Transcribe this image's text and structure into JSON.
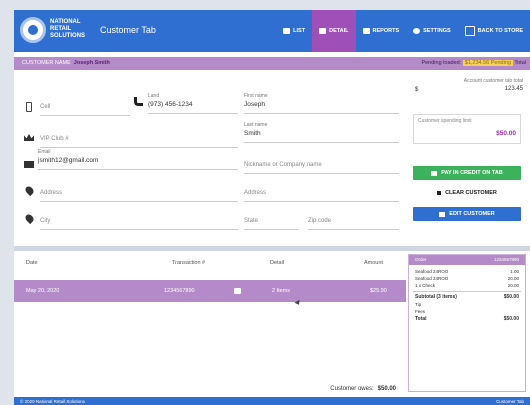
{
  "header": {
    "brand": "National Retail Solutions",
    "title": "Customer Tab",
    "nav": [
      {
        "label": "List",
        "icon": "list-icon"
      },
      {
        "label": "Detail",
        "icon": "detail-icon"
      },
      {
        "label": "Reports",
        "icon": "cloud-icon"
      },
      {
        "label": "Settings",
        "icon": "gear-icon"
      },
      {
        "label": "Back to Store",
        "icon": "grid-icon"
      }
    ]
  },
  "crumb": {
    "section": "Customer Name",
    "name": "Joseph Smith",
    "pending_label": "Pending loaded:",
    "pending_value": "$1,234.56 Pending",
    "total_label": "Total"
  },
  "form": {
    "cell_label": "Cell",
    "landline_label": "Land",
    "landline_value": "(973) 456-1234",
    "first_name_label": "First name",
    "first_name_value": "Joseph",
    "last_name_label": "Last name",
    "last_name_value": "Smith",
    "vip_label": "VIP Club #",
    "email_label": "Email",
    "email_value": "jsmith12@gmail.com",
    "nickname_placeholder": "Nickname or Company name",
    "address_placeholder": "Address",
    "address2_placeholder": "Address",
    "city_placeholder": "City",
    "state_placeholder": "State",
    "zip_placeholder": "Zip code"
  },
  "sidebox": {
    "balance_label": "Account customer tab total",
    "balance_value": "123.45",
    "balance_currency": "$",
    "limit_label": "Customer spending limit",
    "limit_value": "$50.00",
    "pay_button": "Pay in credit on tab",
    "clear_button": "Clear customer",
    "edit_button": "Edit customer"
  },
  "table": {
    "headers": [
      "Date",
      "Transaction #",
      "Detail",
      "Amount"
    ],
    "row": {
      "date": "May 20, 2020",
      "transaction": "1234567890",
      "detail": "2 Items",
      "amount": "$25.90"
    },
    "total_label": "Customer owes:",
    "total_value": "$50.00"
  },
  "receipt": {
    "header_left": "Order",
    "header_right": "1234567890",
    "lines": [
      {
        "label": "Seafood 24ROO",
        "value": "1.00"
      },
      {
        "label": "Seafood 24ROO",
        "value": "20.00"
      },
      {
        "label": "1 x Check",
        "value": "20.00"
      }
    ],
    "subtotal_label": "Subtotal (3 items)",
    "subtotal_value": "$50.00",
    "tip_label": "Tip",
    "fees_label": "Fees",
    "total_label": "Total",
    "total_value": "$50.00"
  },
  "footer": {
    "left": "© 2020 National Retail Solutions",
    "right": "Customer Tab"
  }
}
